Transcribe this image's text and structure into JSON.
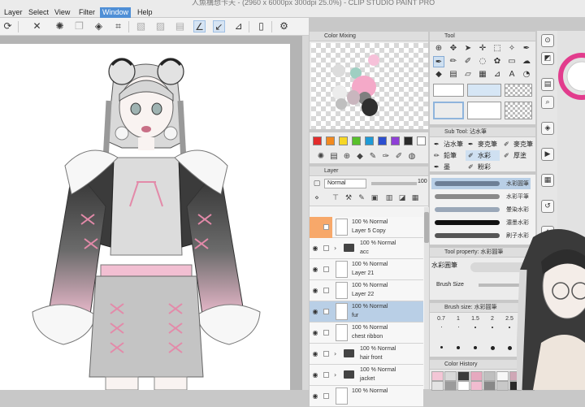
{
  "window": {
    "title": "人魚構想卡天 -  (2960 x 6000px 300dpi 25.0%)  - CLIP STUDIO PAINT PRO"
  },
  "menu": {
    "items": [
      {
        "label": "Layer",
        "active": false
      },
      {
        "label": "Select",
        "active": false
      },
      {
        "label": "View",
        "active": false
      },
      {
        "label": "Filter",
        "active": false
      },
      {
        "label": "Window",
        "active": true
      },
      {
        "label": "Help",
        "active": false
      }
    ]
  },
  "panels": {
    "color_mixing": {
      "title": "Color Mixing"
    },
    "tool": {
      "title": "Tool"
    },
    "sub_tool": {
      "title": "Sub Tool: 沾水筆"
    },
    "layer": {
      "title": "Layer"
    },
    "tool_property": {
      "title": "Tool property: 水彩圓筆",
      "tab": "水彩圓筆",
      "brush_size_label": "Brush Size"
    },
    "brush_size": {
      "title": "Brush size: 水彩圓筆"
    },
    "color_history": {
      "title": "Color History"
    }
  },
  "sub_tools": [
    {
      "label": "沾水筆",
      "active": false
    },
    {
      "label": "麥克筆",
      "active": false
    },
    {
      "label": "鉛筆",
      "active": false
    },
    {
      "label": "水彩",
      "active": true
    },
    {
      "label": "厚塗",
      "active": false
    },
    {
      "label": "墨",
      "active": false
    },
    {
      "label": "粉彩",
      "active": false
    }
  ],
  "brushes": [
    {
      "label": "水彩圓筆",
      "color": "#6d7f96",
      "selected": true
    },
    {
      "label": "水彩平筆",
      "color": "#8a8a8a",
      "selected": false
    },
    {
      "label": "暈染水彩",
      "color": "#9aa7b8",
      "selected": false
    },
    {
      "label": "濃墨水彩",
      "color": "#111111",
      "selected": false
    },
    {
      "label": "刷子水彩",
      "color": "#555555",
      "selected": false
    }
  ],
  "layer_panel": {
    "blend_mode": "Normal",
    "opacity": "100",
    "layers": [
      {
        "mode": "100 % Normal",
        "name": "Layer 5 Copy",
        "type": "layer",
        "selected": false,
        "orange": true,
        "visible": false
      },
      {
        "mode": "100 % Normal",
        "name": "acc",
        "type": "folder",
        "selected": false,
        "orange": false,
        "visible": true
      },
      {
        "mode": "100 % Normal",
        "name": "Layer 21",
        "type": "layer",
        "selected": false,
        "orange": false,
        "visible": true
      },
      {
        "mode": "100 % Normal",
        "name": "Layer 22",
        "type": "layer",
        "selected": false,
        "orange": false,
        "visible": true
      },
      {
        "mode": "100 % Normal",
        "name": "fur",
        "type": "layer",
        "selected": true,
        "orange": false,
        "visible": true
      },
      {
        "mode": "100 % Normal",
        "name": "chest ribbon",
        "type": "layer",
        "selected": false,
        "orange": false,
        "visible": true
      },
      {
        "mode": "100 % Normal",
        "name": "hair front",
        "type": "folder",
        "selected": false,
        "orange": false,
        "visible": true
      },
      {
        "mode": "100 % Normal",
        "name": "jacket",
        "type": "folder",
        "selected": false,
        "orange": false,
        "visible": true
      },
      {
        "mode": "100 % Normal",
        "name": "",
        "type": "layer",
        "selected": false,
        "orange": false,
        "visible": true
      }
    ]
  },
  "brush_sizes": [
    {
      "value": "0.7",
      "dot": 1
    },
    {
      "value": "1",
      "dot": 1
    },
    {
      "value": "1.5",
      "dot": 2
    },
    {
      "value": "2",
      "dot": 2
    },
    {
      "value": "2.5",
      "dot": 2
    },
    {
      "value": "3",
      "dot": 3
    },
    {
      "value": "",
      "dot": 3
    },
    {
      "value": "",
      "dot": 4
    },
    {
      "value": "",
      "dot": 4
    },
    {
      "value": "",
      "dot": 5
    },
    {
      "value": "",
      "dot": 5
    },
    {
      "value": "",
      "dot": 6
    }
  ],
  "color_history": [
    "#f3c6d6",
    "#d9d9d9",
    "#3b3b3b",
    "#e6a9bf",
    "#bfbfbf",
    "#f7f7f7",
    "#cfa7b6",
    "#555555",
    "#e3e3e3",
    "#9b9b9b",
    "#ffffff",
    "#f1bcd0",
    "#888888",
    "#c8c8c8",
    "#2a2a2a",
    "#eeeeee"
  ],
  "mixing_blobs": [
    {
      "color": "#f6c1d9"
    },
    {
      "color": "#dcdcdc"
    },
    {
      "color": "#9fcfc2"
    },
    {
      "color": "#f4a9c8"
    },
    {
      "color": "#7f7f7f"
    },
    {
      "color": "#2f2f2f"
    },
    {
      "color": "#ececec"
    },
    {
      "color": "#c9b6be"
    },
    {
      "color": "#bfbfbf"
    }
  ],
  "swatches": [
    "#e32c2c",
    "#f28a1f",
    "#f6d726",
    "#58c02b",
    "#1e9ad6",
    "#2c4fd0",
    "#8e3fd6",
    "#2a2a2a",
    "#ffffff"
  ],
  "colors": {
    "accent": "#4f8fd6",
    "selected_layer": "#b9cfe6",
    "orange_marker": "#f7a86a",
    "main_color": "#ffffff",
    "sub_color": "#d6e6f5"
  }
}
